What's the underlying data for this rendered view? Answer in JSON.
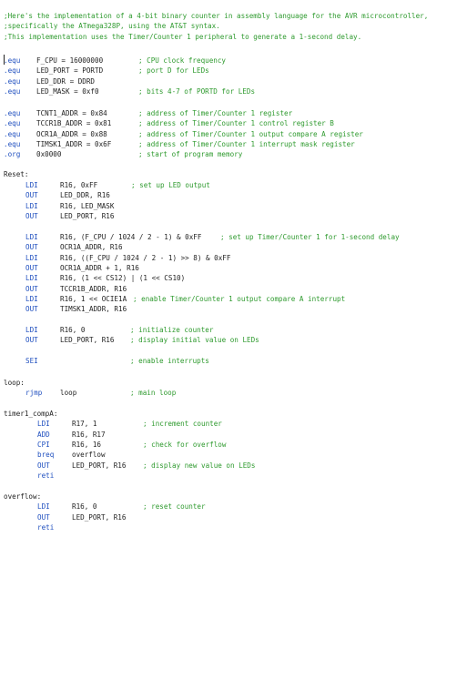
{
  "header_comments": [
    ";Here's the implementation of a 4-bit binary counter in assembly language for the AVR microcontroller,",
    ";specifically the ATmega328P, using the AT&T syntax.",
    ";This implementation uses the Timer/Counter 1 peripheral to generate a 1-second delay."
  ],
  "equ_block_1": [
    {
      "kw": ".equ",
      "arg": "F_CPU = 16000000",
      "comment": "; CPU clock frequency"
    },
    {
      "kw": ".equ",
      "arg": "LED_PORT = PORTD",
      "comment": "; port D for LEDs"
    },
    {
      "kw": ".equ",
      "arg": "LED_DDR = DDRD",
      "comment": ""
    },
    {
      "kw": ".equ",
      "arg": "LED_MASK = 0xf0",
      "comment": "; bits 4-7 of PORTD for LEDs"
    }
  ],
  "equ_block_2": [
    {
      "kw": ".equ",
      "arg": "TCNT1_ADDR = 0x84",
      "comment": "; address of Timer/Counter 1 register"
    },
    {
      "kw": ".equ",
      "arg": "TCCR1B_ADDR = 0x81",
      "comment": "; address of Timer/Counter 1 control register B"
    },
    {
      "kw": ".equ",
      "arg": "OCR1A_ADDR = 0x88",
      "comment": "; address of Timer/Counter 1 output compare A register"
    },
    {
      "kw": ".equ",
      "arg": "TIMSK1_ADDR = 0x6F",
      "comment": "; address of Timer/Counter 1 interrupt mask register"
    },
    {
      "kw": ".org",
      "arg": "0x0000",
      "comment": "; start of program memory"
    }
  ],
  "reset": {
    "label": "Reset:",
    "block1": [
      {
        "op": "LDI",
        "args": "R16, 0xFF",
        "comment": "; set up LED output"
      },
      {
        "op": "OUT",
        "args": "LED_DDR, R16",
        "comment": ""
      },
      {
        "op": "LDI",
        "args": "R16, LED_MASK",
        "comment": ""
      },
      {
        "op": "OUT",
        "args": "LED_PORT, R16",
        "comment": ""
      }
    ],
    "block2": [
      {
        "op": "LDI",
        "args": "R16, (F_CPU / 1024 / 2 - 1) & 0xFF",
        "comment": "; set up Timer/Counter 1 for 1-second delay"
      },
      {
        "op": "OUT",
        "args": "OCR1A_ADDR, R16",
        "comment": ""
      },
      {
        "op": "LDI",
        "args": "R16, ((F_CPU / 1024 / 2 - 1) >> 8) & 0xFF",
        "comment": ""
      },
      {
        "op": "OUT",
        "args": "OCR1A_ADDR + 1, R16",
        "comment": ""
      },
      {
        "op": "LDI",
        "args": "R16, (1 << CS12) | (1 << CS10)",
        "comment": ""
      },
      {
        "op": "OUT",
        "args": "TCCR1B_ADDR, R16",
        "comment": ""
      },
      {
        "op": "LDI",
        "args": "R16, 1 << OCIE1A",
        "comment": "; enable Timer/Counter 1 output compare A interrupt"
      },
      {
        "op": "OUT",
        "args": "TIMSK1_ADDR, R16",
        "comment": ""
      }
    ],
    "block3": [
      {
        "op": "LDI",
        "args": "R16, 0",
        "comment": "; initialize counter"
      },
      {
        "op": "OUT",
        "args": "LED_PORT, R16",
        "comment": "; display initial value on LEDs"
      }
    ],
    "sei": {
      "op": "SEI",
      "args": "",
      "comment": "; enable interrupts"
    }
  },
  "loop": {
    "label": "loop:",
    "line": {
      "op": "rjmp",
      "args": "loop",
      "comment": "; main loop"
    }
  },
  "timer": {
    "label": "timer1_compA:",
    "lines": [
      {
        "op": "LDI",
        "args": "R17, 1",
        "comment": "; increment counter"
      },
      {
        "op": "ADD",
        "args": "R16, R17",
        "comment": ""
      },
      {
        "op": "CPI",
        "args": "R16, 16",
        "comment": "; check for overflow"
      },
      {
        "op": "breq",
        "args": "overflow",
        "comment": ""
      },
      {
        "op": "OUT",
        "args": "LED_PORT, R16",
        "comment": "; display new value on LEDs"
      },
      {
        "op": "reti",
        "args": "",
        "comment": ""
      }
    ]
  },
  "overflow": {
    "label": "overflow:",
    "lines": [
      {
        "op": "LDI",
        "args": "R16, 0",
        "comment": "; reset counter"
      },
      {
        "op": "OUT",
        "args": "LED_PORT, R16",
        "comment": ""
      },
      {
        "op": "reti",
        "args": "",
        "comment": ""
      }
    ]
  },
  "colors": {
    "comment": "#2e9a2e",
    "keyword": "#1f4fbf",
    "text": "#222222"
  }
}
